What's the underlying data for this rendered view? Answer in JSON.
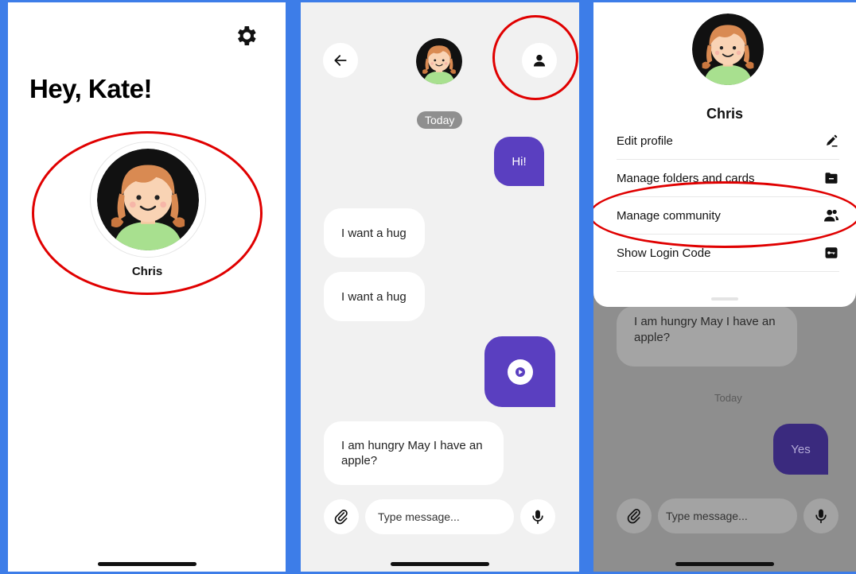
{
  "home": {
    "greeting": "Hey, Kate!",
    "contact_name": "Chris",
    "settings_icon": "gear-icon"
  },
  "chat": {
    "date_label": "Today",
    "messages": [
      {
        "direction": "out",
        "text": "Hi!"
      },
      {
        "direction": "in",
        "text": "I want a hug"
      },
      {
        "direction": "in",
        "text": "I want a hug"
      },
      {
        "direction": "out",
        "type": "audio",
        "icon": "play-icon"
      },
      {
        "direction": "in",
        "text": "I am hungry May I have an apple?"
      }
    ],
    "input_placeholder": "Type message...",
    "icons": [
      "back-arrow-icon",
      "person-icon",
      "paperclip-icon",
      "microphone-icon"
    ]
  },
  "profile_sheet": {
    "name": "Chris",
    "menu": [
      {
        "label": "Edit profile",
        "icon": "pencil-icon"
      },
      {
        "label": "Manage folders and cards",
        "icon": "folder-icon"
      },
      {
        "label": "Manage community",
        "icon": "people-icon"
      },
      {
        "label": "Show Login Code",
        "icon": "key-icon"
      }
    ],
    "background_chat": {
      "message_in": "I am hungry May I have an apple?",
      "date_label": "Today",
      "message_out": "Yes",
      "input_placeholder": "Type message..."
    }
  },
  "colors": {
    "frame_background": "#3d7de8",
    "accent_purple": "#5a3fc0",
    "annotation_red": "#e00000",
    "avatar_shirt": "#a8e08f",
    "avatar_hair": "#d98a52"
  }
}
